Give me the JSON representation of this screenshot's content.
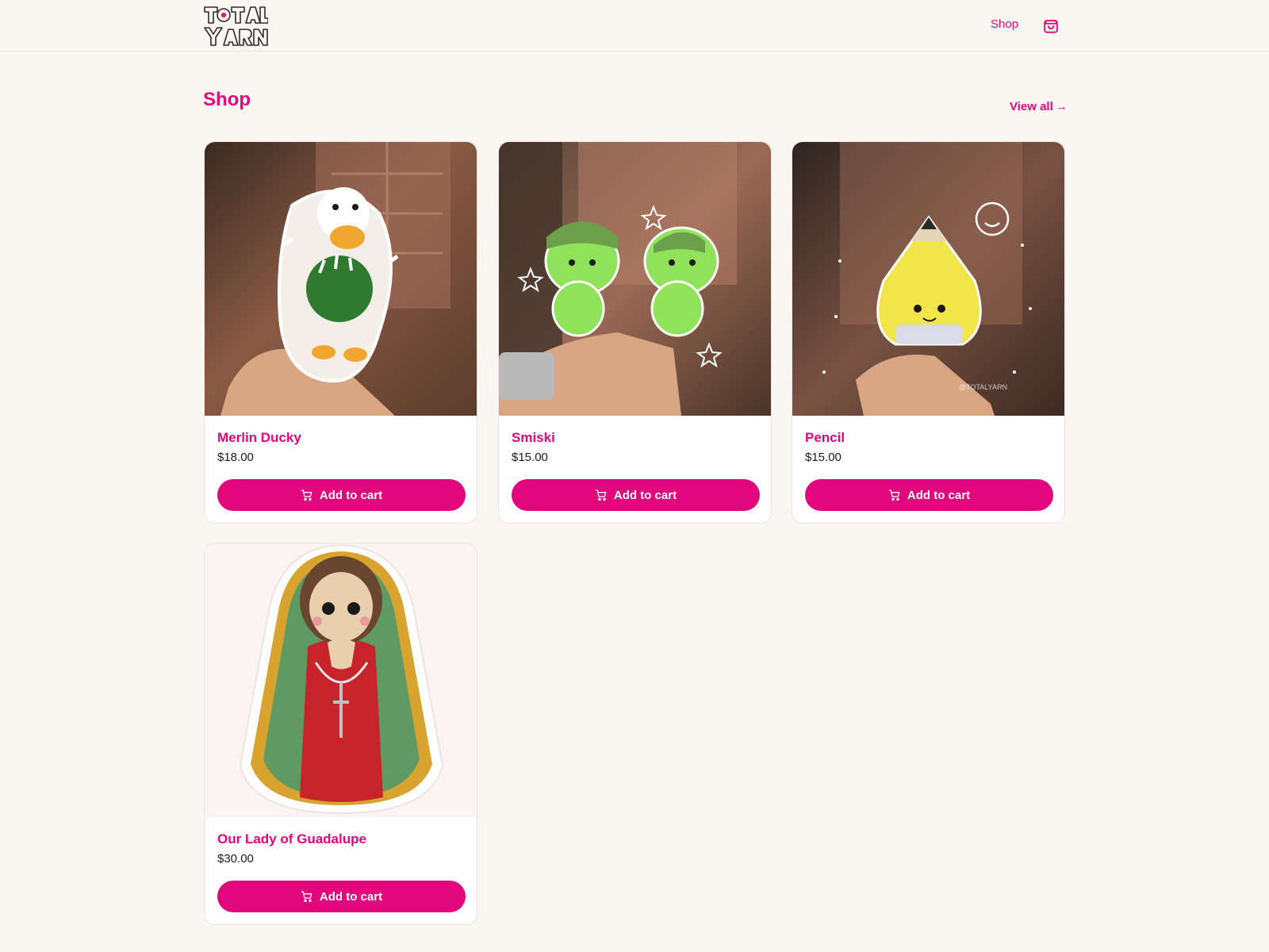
{
  "header": {
    "logo_text": "TOTAL YARN",
    "nav_shop": "Shop",
    "cart_icon": "shopping-bag-icon"
  },
  "section": {
    "title": "Shop",
    "view_all": "View all",
    "view_all_arrow": "→"
  },
  "products": [
    {
      "name": "Merlin Ducky",
      "price": "$18.00",
      "button": "Add to cart",
      "image": "crochet-duck-photo"
    },
    {
      "name": "Smiski",
      "price": "$15.00",
      "button": "Add to cart",
      "image": "crochet-smiski-photo"
    },
    {
      "name": "Pencil",
      "price": "$15.00",
      "button": "Add to cart",
      "image": "crochet-pencil-photo"
    },
    {
      "name": "Our Lady of Guadalupe",
      "price": "$30.00",
      "button": "Add to cart",
      "image": "crochet-guadalupe-photo"
    }
  ],
  "colors": {
    "accent": "#e2067d",
    "background": "#faf6f1",
    "card": "#ffffff"
  }
}
